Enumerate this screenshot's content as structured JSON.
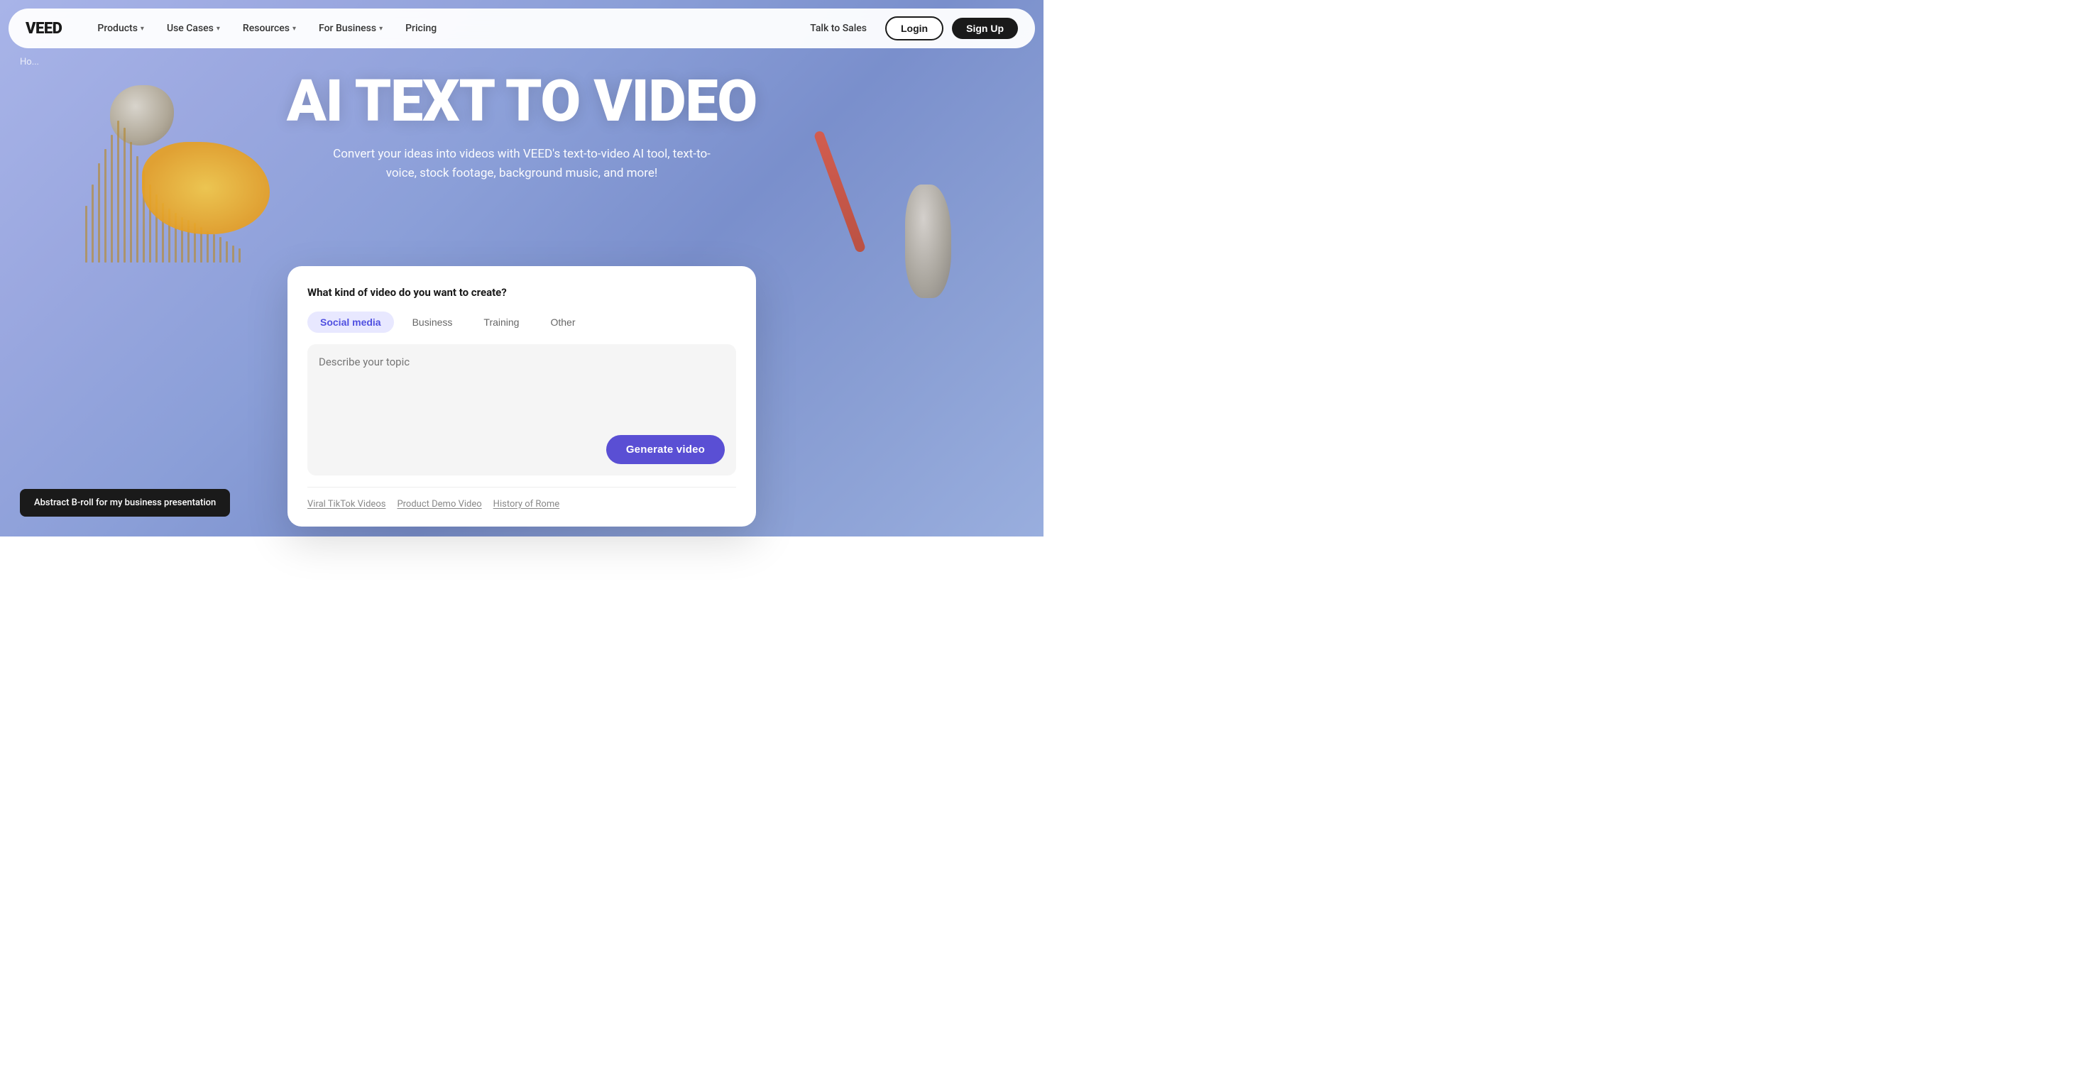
{
  "brand": {
    "logo": "VEED"
  },
  "nav": {
    "items": [
      {
        "label": "Products",
        "has_dropdown": true
      },
      {
        "label": "Use Cases",
        "has_dropdown": true
      },
      {
        "label": "Resources",
        "has_dropdown": true
      },
      {
        "label": "For Business",
        "has_dropdown": true
      },
      {
        "label": "Pricing",
        "has_dropdown": false
      }
    ],
    "talk_to_sales": "Talk to Sales",
    "login": "Login",
    "signup": "Sign Up"
  },
  "hero": {
    "title": "AI TEXT TO VIDEO",
    "subtitle": "Convert your ideas into videos with VEED's text-to-video AI tool, text-to-voice, stock footage, background music, and more!"
  },
  "breadcrumb": "Ho...",
  "card": {
    "question": "What kind of video do you want to create?",
    "tabs": [
      {
        "label": "Social media",
        "active": true
      },
      {
        "label": "Business",
        "active": false
      },
      {
        "label": "Training",
        "active": false
      },
      {
        "label": "Other",
        "active": false
      }
    ],
    "textarea_placeholder": "Describe your topic",
    "generate_button": "Generate video",
    "suggestions": [
      "Viral TikTok Videos",
      "Product Demo Video",
      "History of Rome"
    ]
  },
  "toast": {
    "text": "Abstract B-roll for my business presentation"
  }
}
